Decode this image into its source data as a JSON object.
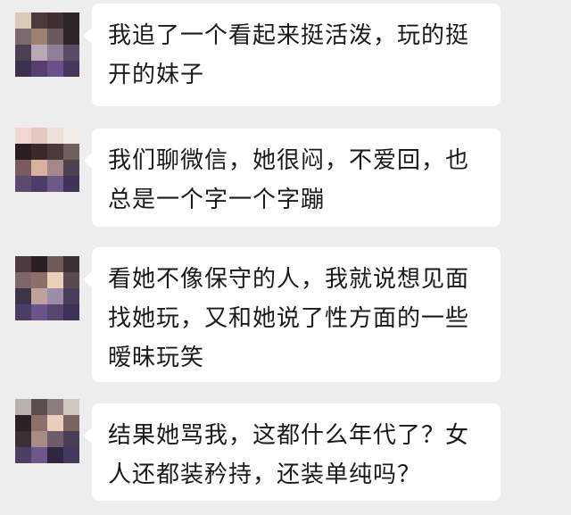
{
  "messages": [
    {
      "text": "我追了一个看起来挺活泼，玩的挺开的妹子",
      "avatar_pixels": [
        "#d7cbb5",
        "#4a3a3c",
        "#3e3033",
        "#2b2528",
        "#7a6a70",
        "#9b8171",
        "#6b5960",
        "#2e2629",
        "#4c3f53",
        "#b7a9b8",
        "#8f7f97",
        "#5a4b67",
        "#3d3150",
        "#563f6f",
        "#6a5187",
        "#45375e"
      ]
    },
    {
      "text": "我们聊微信，她很闷，不爱回，也总是一个字一个字蹦",
      "avatar_pixels": [
        "#f3d6d0",
        "#e4c8c0",
        "#ece0d8",
        "#f0ece6",
        "#2a1e20",
        "#3b2a2b",
        "#4a3b3a",
        "#6f605e",
        "#7a5a5e",
        "#d9b09e",
        "#a5868a",
        "#4c4250",
        "#5b4c6e",
        "#4d3d66",
        "#6e5a86",
        "#3f3458"
      ]
    },
    {
      "text": "看她不像保守的人，我就说想见面找她玩，又和她说了性方面的一些暧昧玩笑",
      "avatar_pixels": [
        "#4b3a3f",
        "#2a2024",
        "#6f5a5b",
        "#3a2f33",
        "#7e6769",
        "#8a6f6a",
        "#ead0b8",
        "#5a4950",
        "#3e3448",
        "#bfa39a",
        "#9c8da6",
        "#4a3d5c",
        "#4c3d66",
        "#6a558a",
        "#57476f",
        "#3c3257"
      ]
    },
    {
      "text": "结果她骂我，这都什么年代了？女人还都装矜持，还装单纯吗？",
      "avatar_pixels": [
        "#b9b1ab",
        "#5a4d50",
        "#8b7e7c",
        "#d1c7c1",
        "#2c2226",
        "#8f6f69",
        "#e9cfbb",
        "#7a6460",
        "#3b2e35",
        "#a88c86",
        "#6d5a6c",
        "#4a3e55",
        "#4d3f63",
        "#6b5789",
        "#2f2740",
        "#453a5b"
      ]
    }
  ]
}
